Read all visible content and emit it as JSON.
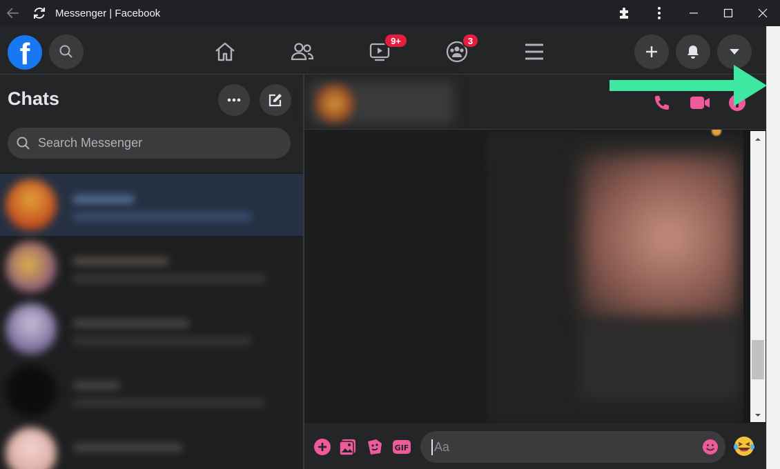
{
  "window": {
    "title": "Messenger | Facebook"
  },
  "topnav": {
    "logo_letter": "f",
    "watch_badge": "9+",
    "groups_badge": "3"
  },
  "sidebar": {
    "title": "Chats",
    "search": {
      "placeholder": "Search Messenger",
      "value": ""
    }
  },
  "composer": {
    "placeholder": "Aa",
    "value": ""
  },
  "colors": {
    "facebook_blue": "#1877f2",
    "accent_pink": "#f0599b",
    "badge_red": "#e41e3f",
    "annotation_arrow": "#3ee8a0"
  },
  "icons": {
    "titlebar": [
      "back-arrow-icon",
      "reload-icon",
      "extension-puzzle-icon",
      "more-vertical-icon",
      "minimize-icon",
      "maximize-icon",
      "close-icon"
    ],
    "nav": [
      "home-icon",
      "friends-icon",
      "watch-icon",
      "groups-icon",
      "menu-icon"
    ],
    "header": [
      "phone-icon",
      "video-camera-icon",
      "info-icon"
    ],
    "composer": [
      "plus-icon",
      "image-icon",
      "sticker-icon",
      "gif-icon",
      "emoji-icon",
      "laughing-emoji-icon"
    ]
  }
}
